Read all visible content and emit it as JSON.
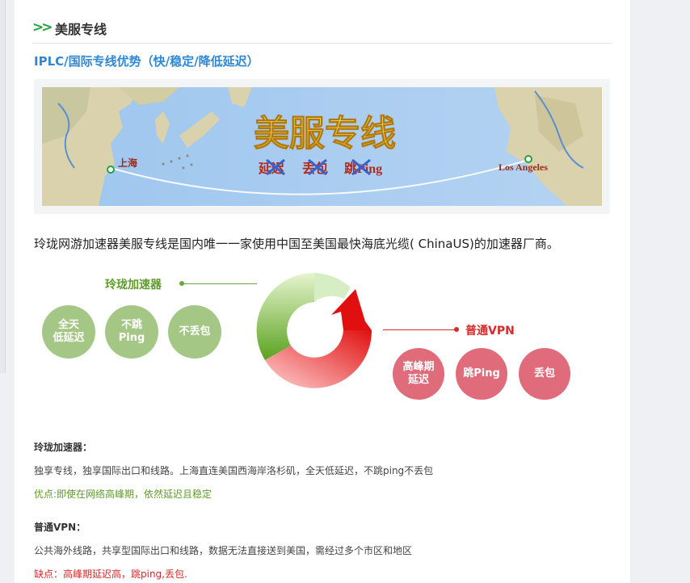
{
  "section": {
    "arrows": ">>",
    "title": "美服专线"
  },
  "subtitle": "IPLC/国际专线优势（快/稳定/降低延迟）",
  "banner": {
    "headline": "美服专线",
    "crossed": [
      "延迟",
      "丢包",
      "跳Ping"
    ],
    "city_left": "上海",
    "city_right": "Los Angeles"
  },
  "intro": "玲珑网游加速器美服专线是国内唯一一家使用中国至美国最快海底光缆( ChinaUS)的加速器厂商。",
  "diagram": {
    "green_label": "玲珑加速器",
    "red_label": "普通VPN",
    "green_circles": [
      {
        "line1": "全天",
        "line2": "低延迟"
      },
      {
        "line1": "不跳",
        "line2": "Ping"
      },
      {
        "line1": "不丢包",
        "line2": ""
      }
    ],
    "red_circles": [
      {
        "line1": "高峰期",
        "line2": "延迟"
      },
      {
        "line1": "跳Ping",
        "line2": ""
      },
      {
        "line1": "丢包",
        "line2": ""
      }
    ]
  },
  "details": {
    "ll_head": "玲珑加速器：",
    "ll_body": "独享专线，独享国际出口和线路。上海直连美国西海岸洛杉矶，全天低延迟，不跳ping不丢包",
    "ll_adv": "优点:即使在网络高峰期，依然延迟且稳定",
    "vpn_head": "普通VPN：",
    "vpn_body": "公共海外线路，共享型国际出口和线路，数据无法直接送到美国，需经过多个市区和地区",
    "vpn_dis": "缺点：高峰期延迟高，跳ping,丢包."
  },
  "colors": {
    "accent_blue": "#2e88d6",
    "green": "#5e9b2b",
    "red": "#d82a2a"
  }
}
